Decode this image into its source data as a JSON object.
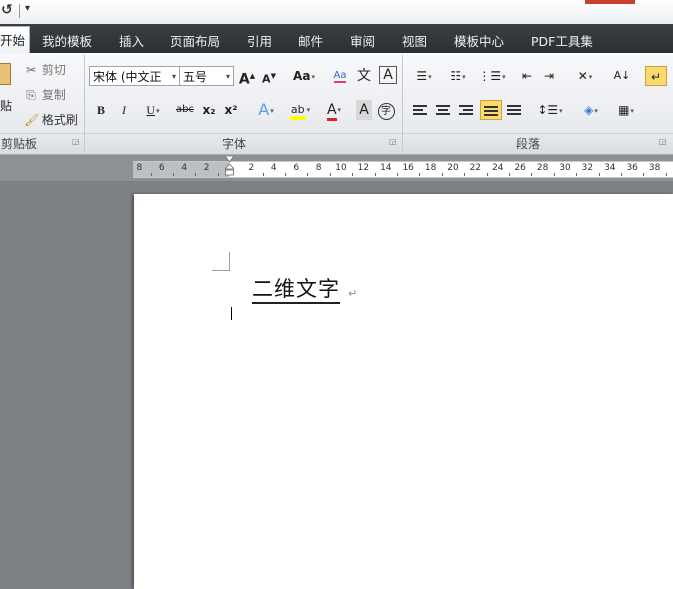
{
  "qat": {
    "undo_icon": "undo-icon",
    "dropdown_icon": "customize-dropdown-icon"
  },
  "tabs": [
    "开始",
    "我的模板",
    "插入",
    "页面布局",
    "引用",
    "邮件",
    "审阅",
    "视图",
    "模板中心",
    "PDF工具集"
  ],
  "active_tab": "开始",
  "clipboard": {
    "paste_label": "贴",
    "cut_label": "剪切",
    "copy_label": "复制",
    "format_painter_label": "格式刷",
    "group_label": "剪贴板"
  },
  "font": {
    "font_name": "宋体 (中文正",
    "font_size": "五号",
    "grow_label": "A",
    "shrink_label": "A",
    "change_case_label": "Aa",
    "clear_format_label": "Aa",
    "pinyin_label": "文",
    "border_label": "A",
    "bold": "B",
    "italic": "I",
    "underline": "U",
    "strike": "abc",
    "subscript": "x₂",
    "superscript": "x²",
    "effects": "A",
    "highlight": "ab",
    "color": "A",
    "shading": "A",
    "enclose": "字",
    "group_label": "字体"
  },
  "paragraph": {
    "group_label": "段落"
  },
  "ruler": {
    "labels": [
      "8",
      "6",
      "4",
      "2",
      "2",
      "4",
      "6",
      "8",
      "10",
      "12",
      "14",
      "16",
      "18",
      "20",
      "22",
      "24",
      "26",
      "28",
      "30",
      "32",
      "34",
      "36",
      "38"
    ]
  },
  "document": {
    "text": "二维文字",
    "para_mark": "↵",
    "caret_mark": "↵"
  },
  "colors": {
    "tab_bg": "#2f3237",
    "ribbon_bg": "#eef0f3",
    "selected": "#fbd96d",
    "highlight_yellow": "#ffff00",
    "font_red": "#e02020"
  }
}
